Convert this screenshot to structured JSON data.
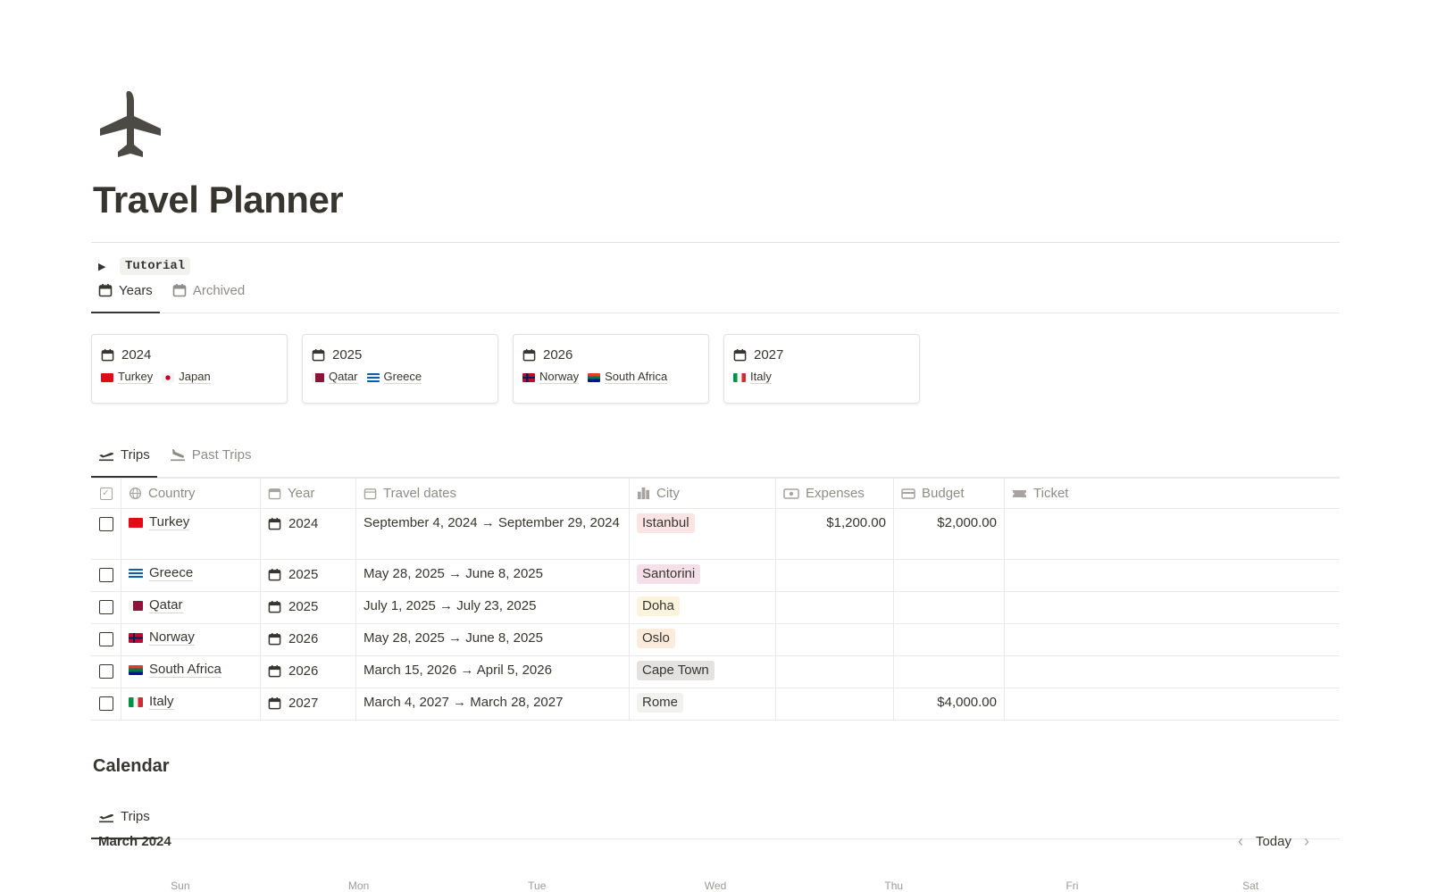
{
  "page": {
    "icon": "airplane-icon",
    "title": "Travel Planner"
  },
  "tutorial": {
    "label": "Tutorial"
  },
  "year_tabs": [
    {
      "label": "Years",
      "icon": "calendar-icon",
      "active": true
    },
    {
      "label": "Archived",
      "icon": "calendar-icon",
      "active": false
    }
  ],
  "year_cards": [
    {
      "year": "2024",
      "countries": [
        {
          "name": "Turkey",
          "flag": "turkey-flag-icon"
        },
        {
          "name": "Japan",
          "flag": "japan-flag-icon"
        }
      ]
    },
    {
      "year": "2025",
      "countries": [
        {
          "name": "Qatar",
          "flag": "qatar-flag-icon"
        },
        {
          "name": "Greece",
          "flag": "greece-flag-icon"
        }
      ]
    },
    {
      "year": "2026",
      "countries": [
        {
          "name": "Norway",
          "flag": "norway-flag-icon"
        },
        {
          "name": "South Africa",
          "flag": "south-africa-flag-icon"
        }
      ]
    },
    {
      "year": "2027",
      "countries": [
        {
          "name": "Italy",
          "flag": "italy-flag-icon"
        }
      ]
    }
  ],
  "trip_tabs": [
    {
      "label": "Trips",
      "icon": "airplane-departure-icon",
      "active": true
    },
    {
      "label": "Past Trips",
      "icon": "airplane-arrival-icon",
      "active": false
    }
  ],
  "table": {
    "headers": {
      "country": "Country",
      "year": "Year",
      "dates": "Travel dates",
      "city": "City",
      "expenses": "Expenses",
      "budget": "Budget",
      "ticket": "Ticket"
    },
    "rows": [
      {
        "country": "Turkey",
        "flag": "turkey-flag-icon",
        "year": "2024",
        "dates": "September 4, 2024 → September 29, 2024",
        "city": "Istanbul",
        "city_color": "#fbe4e4",
        "expenses": "$1,200.00",
        "budget": "$2,000.00",
        "ticket": ""
      },
      {
        "country": "Greece",
        "flag": "greece-flag-icon",
        "year": "2025",
        "dates": "May 28, 2025 → June 8, 2025",
        "city": "Santorini",
        "city_color": "#f5e0e9",
        "expenses": "",
        "budget": "",
        "ticket": ""
      },
      {
        "country": "Qatar",
        "flag": "qatar-flag-icon",
        "year": "2025",
        "dates": "July 1, 2025 → July 23, 2025",
        "city": "Doha",
        "city_color": "#fbf3db",
        "expenses": "",
        "budget": "",
        "ticket": ""
      },
      {
        "country": "Norway",
        "flag": "norway-flag-icon",
        "year": "2026",
        "dates": "May 28, 2025 → June 8, 2025",
        "city": "Oslo",
        "city_color": "#faebdd",
        "expenses": "",
        "budget": "",
        "ticket": ""
      },
      {
        "country": "South Africa",
        "flag": "south-africa-flag-icon",
        "year": "2026",
        "dates": "March 15, 2026 → April 5, 2026",
        "city": "Cape Town",
        "city_color": "#e3e2e0",
        "expenses": "",
        "budget": "",
        "ticket": ""
      },
      {
        "country": "Italy",
        "flag": "italy-flag-icon",
        "year": "2027",
        "dates": "March 4, 2027 → March 28, 2027",
        "city": "Rome",
        "city_color": "#f1f1ef",
        "expenses": "",
        "budget": "$4,000.00",
        "ticket": ""
      }
    ]
  },
  "calendar": {
    "title": "Calendar",
    "tab": "Trips",
    "month": "March 2024",
    "today_label": "Today",
    "weekdays": [
      "Sun",
      "Mon",
      "Tue",
      "Wed",
      "Thu",
      "Fri",
      "Sat"
    ]
  },
  "colors": {
    "text": "#37352f",
    "muted": "#8e8c88",
    "border": "#e9e9e7"
  }
}
